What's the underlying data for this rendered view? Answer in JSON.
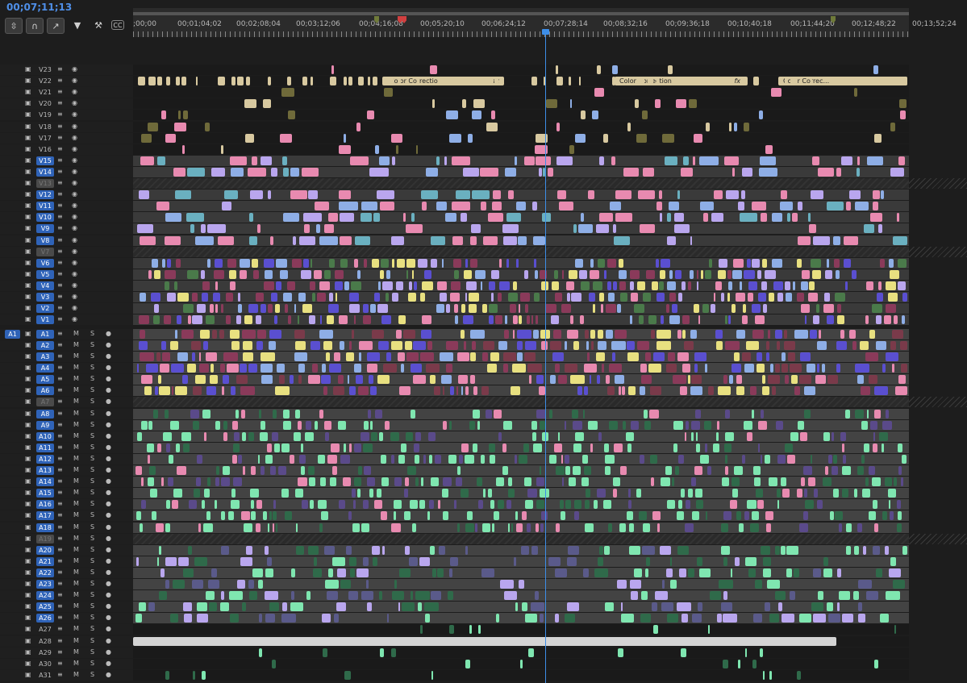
{
  "timecode": "00;07;11;13",
  "toolbar": {
    "icons": [
      "insert-snap-icon",
      "magnet-icon",
      "linked-selection-icon",
      "marker-icon",
      "wrench-icon",
      "captions-icon"
    ],
    "captions_label": "CC"
  },
  "ruler": {
    "labels": [
      ";00;00",
      "00;01;04;02",
      "00;02;08;04",
      "00;03;12;06",
      "00;04;16;08",
      "00;05;20;10",
      "00;06;24;12",
      "00;07;28;14",
      "00;08;32;16",
      "00;09;36;18",
      "00;10;40;18",
      "00;11;44;20",
      "00;12;48;22",
      "00;13;52;24"
    ]
  },
  "source_patch": "A1",
  "button_labels": {
    "mute": "M",
    "solo": "S"
  },
  "video_tracks": [
    {
      "name": "V23",
      "targeted": false,
      "locked": false
    },
    {
      "name": "V22",
      "targeted": false,
      "locked": false
    },
    {
      "name": "V21",
      "targeted": false,
      "locked": false
    },
    {
      "name": "V20",
      "targeted": false,
      "locked": false
    },
    {
      "name": "V19",
      "targeted": false,
      "locked": false
    },
    {
      "name": "V18",
      "targeted": false,
      "locked": false
    },
    {
      "name": "V17",
      "targeted": false,
      "locked": false
    },
    {
      "name": "V16",
      "targeted": false,
      "locked": false
    },
    {
      "name": "V15",
      "targeted": true,
      "locked": false
    },
    {
      "name": "V14",
      "targeted": true,
      "locked": false
    },
    {
      "name": "V13",
      "targeted": false,
      "locked": true
    },
    {
      "name": "V12",
      "targeted": true,
      "locked": false
    },
    {
      "name": "V11",
      "targeted": true,
      "locked": false
    },
    {
      "name": "V10",
      "targeted": true,
      "locked": false
    },
    {
      "name": "V9",
      "targeted": true,
      "locked": false
    },
    {
      "name": "V8",
      "targeted": true,
      "locked": false
    },
    {
      "name": "V7",
      "targeted": false,
      "locked": true
    },
    {
      "name": "V6",
      "targeted": true,
      "locked": false
    },
    {
      "name": "V5",
      "targeted": true,
      "locked": false
    },
    {
      "name": "V4",
      "targeted": true,
      "locked": false
    },
    {
      "name": "V3",
      "targeted": true,
      "locked": false
    },
    {
      "name": "V2",
      "targeted": true,
      "locked": false
    },
    {
      "name": "V1",
      "targeted": true,
      "locked": false
    }
  ],
  "audio_tracks": [
    {
      "name": "A1",
      "targeted": true,
      "locked": false
    },
    {
      "name": "A2",
      "targeted": true,
      "locked": false
    },
    {
      "name": "A3",
      "targeted": true,
      "locked": false
    },
    {
      "name": "A4",
      "targeted": true,
      "locked": false
    },
    {
      "name": "A5",
      "targeted": true,
      "locked": false
    },
    {
      "name": "A6",
      "targeted": true,
      "locked": false
    },
    {
      "name": "A7",
      "targeted": false,
      "locked": true
    },
    {
      "name": "A8",
      "targeted": true,
      "locked": false
    },
    {
      "name": "A9",
      "targeted": true,
      "locked": false
    },
    {
      "name": "A10",
      "targeted": true,
      "locked": false
    },
    {
      "name": "A11",
      "targeted": true,
      "locked": false
    },
    {
      "name": "A12",
      "targeted": true,
      "locked": false
    },
    {
      "name": "A13",
      "targeted": true,
      "locked": false
    },
    {
      "name": "A14",
      "targeted": true,
      "locked": false
    },
    {
      "name": "A15",
      "targeted": true,
      "locked": false
    },
    {
      "name": "A16",
      "targeted": true,
      "locked": false
    },
    {
      "name": "A17",
      "targeted": true,
      "locked": false
    },
    {
      "name": "A18",
      "targeted": true,
      "locked": false
    },
    {
      "name": "A19",
      "targeted": false,
      "locked": true
    },
    {
      "name": "A20",
      "targeted": true,
      "locked": false
    },
    {
      "name": "A21",
      "targeted": true,
      "locked": false
    },
    {
      "name": "A22",
      "targeted": true,
      "locked": false
    },
    {
      "name": "A23",
      "targeted": true,
      "locked": false
    },
    {
      "name": "A24",
      "targeted": true,
      "locked": false
    },
    {
      "name": "A25",
      "targeted": true,
      "locked": false
    },
    {
      "name": "A26",
      "targeted": true,
      "locked": false
    },
    {
      "name": "A27",
      "targeted": false,
      "locked": false
    },
    {
      "name": "A28",
      "targeted": false,
      "locked": false
    },
    {
      "name": "A29",
      "targeted": false,
      "locked": false
    },
    {
      "name": "A30",
      "targeted": false,
      "locked": false
    },
    {
      "name": "A31",
      "targeted": false,
      "locked": false
    }
  ],
  "adjustment_clips": [
    {
      "label": "Color Correction",
      "fx": "fx"
    },
    {
      "label": "Color Correction",
      "fx": "fx"
    },
    {
      "label": "Color Correc...",
      "fx": ""
    }
  ],
  "colors": {
    "accent": "#2f63b8",
    "playhead": "#3d8ee8",
    "pink": "#e88ab0",
    "lavender": "#b9a6ee",
    "blue": "#8eaee6",
    "violet": "#5a4fd0",
    "yellow": "#e8e080",
    "olive": "#6f6a3a",
    "mint": "#7fe6b0",
    "darkgreen": "#2f6a4a",
    "tan": "#d8c9a0",
    "mauve": "#8a3a5a"
  }
}
